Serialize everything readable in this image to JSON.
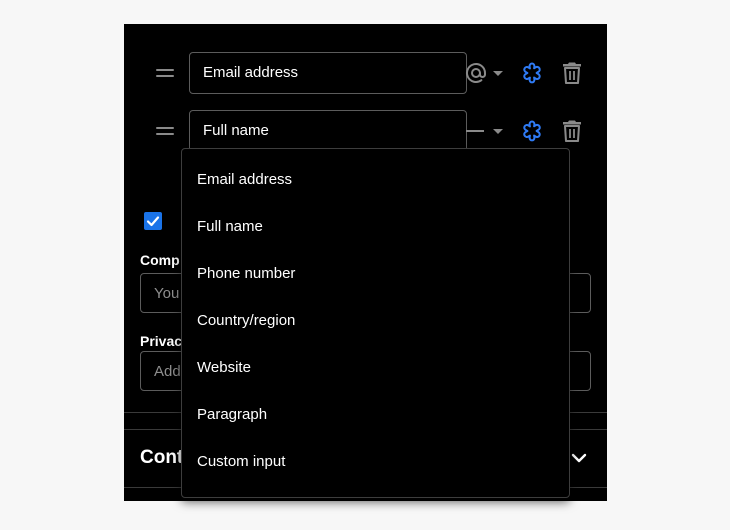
{
  "fields": [
    {
      "value": "Email address",
      "type_icon": "at-icon"
    },
    {
      "value": "Full name",
      "type_icon": "dash-icon"
    }
  ],
  "form": {
    "company_label": "Comp",
    "company_placeholder": "You",
    "privacy_label": "Privac",
    "privacy_placeholder": "Add"
  },
  "section": {
    "title": "Cont"
  },
  "dropdown": {
    "options": [
      "Email address",
      "Full name",
      "Phone number",
      "Country/region",
      "Website",
      "Paragraph",
      "Custom input"
    ]
  },
  "colors": {
    "accent": "#1a73e8",
    "required_icon": "#2f7bf5",
    "background": "#000000"
  }
}
